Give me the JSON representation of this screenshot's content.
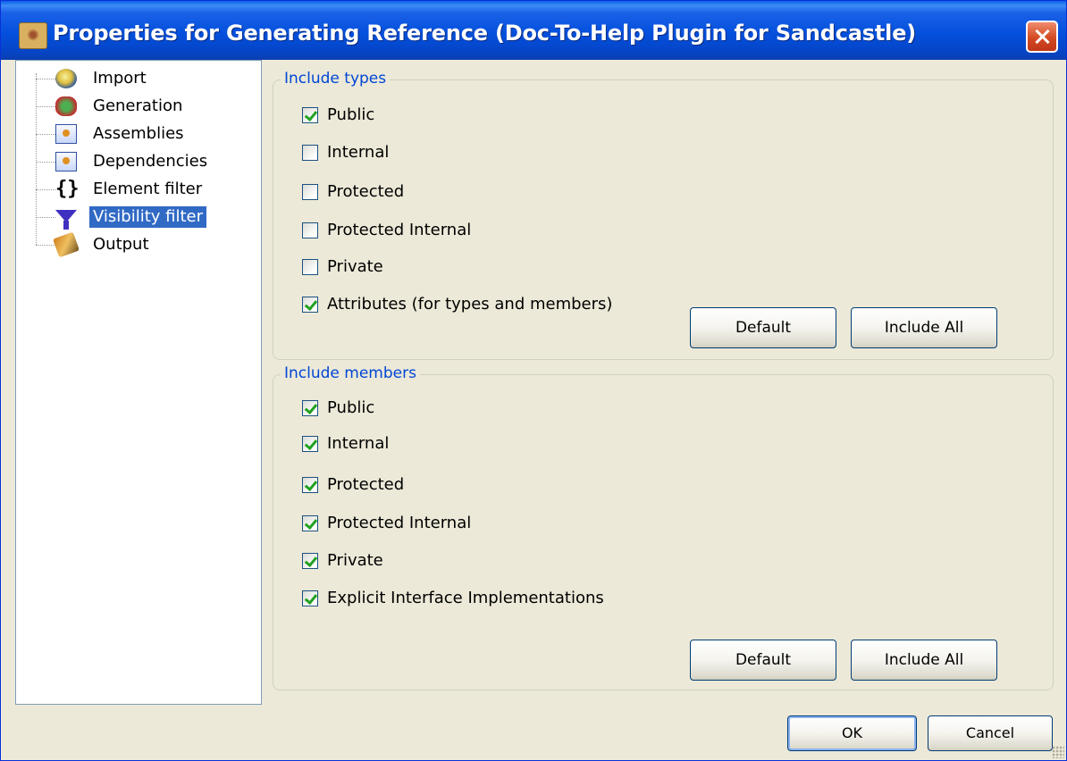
{
  "window": {
    "title": "Properties for Generating Reference (Doc-To-Help Plugin for Sandcastle)"
  },
  "tree": {
    "items": [
      {
        "label": "Import",
        "icon": "import-icon"
      },
      {
        "label": "Generation",
        "icon": "generation-icon"
      },
      {
        "label": "Assemblies",
        "icon": "assembly-icon"
      },
      {
        "label": "Dependencies",
        "icon": "assembly-icon"
      },
      {
        "label": "Element filter",
        "icon": "braces-icon"
      },
      {
        "label": "Visibility filter",
        "icon": "funnel-icon",
        "selected": true
      },
      {
        "label": "Output",
        "icon": "output-icon"
      }
    ]
  },
  "include_types": {
    "title": "Include types",
    "options": [
      {
        "label": "Public",
        "checked": true
      },
      {
        "label": "Internal",
        "checked": false
      },
      {
        "label": "Protected",
        "checked": false
      },
      {
        "label": "Protected Internal",
        "checked": false
      },
      {
        "label": "Private",
        "checked": false
      },
      {
        "label": "Attributes (for types and members)",
        "checked": true
      }
    ],
    "default_label": "Default",
    "include_all_label": "Include All"
  },
  "include_members": {
    "title": "Include members",
    "options": [
      {
        "label": "Public",
        "checked": true
      },
      {
        "label": "Internal",
        "checked": true
      },
      {
        "label": "Protected",
        "checked": true
      },
      {
        "label": "Protected Internal",
        "checked": true
      },
      {
        "label": "Private",
        "checked": true
      },
      {
        "label": "Explicit Interface Implementations",
        "checked": true
      }
    ],
    "default_label": "Default",
    "include_all_label": "Include All"
  },
  "footer": {
    "ok_label": "OK",
    "cancel_label": "Cancel"
  }
}
